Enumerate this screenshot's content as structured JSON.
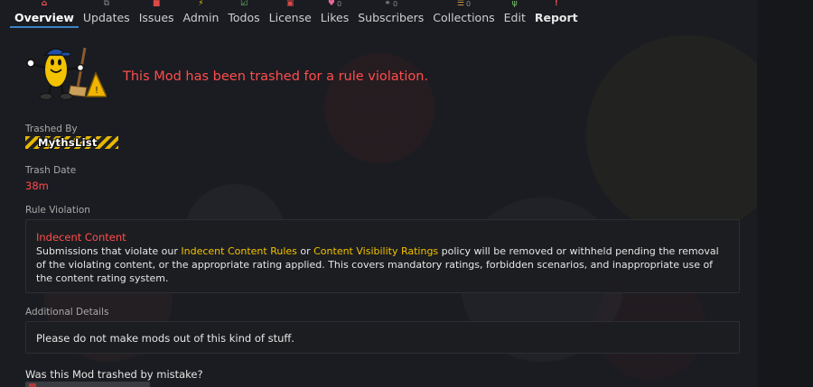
{
  "tabs": [
    {
      "label": "Overview",
      "icon": "home-icon",
      "glyph": "⌂",
      "count": "",
      "active": true
    },
    {
      "label": "Updates",
      "icon": "updates-icon",
      "glyph": "⧉",
      "count": ""
    },
    {
      "label": "Issues",
      "icon": "issues-icon",
      "glyph": "■",
      "count": ""
    },
    {
      "label": "Admin",
      "icon": "admin-icon",
      "glyph": "⚡",
      "count": ""
    },
    {
      "label": "Todos",
      "icon": "todos-icon",
      "glyph": "☑",
      "count": ""
    },
    {
      "label": "License",
      "icon": "license-icon",
      "glyph": "▣",
      "count": ""
    },
    {
      "label": "Likes",
      "icon": "likes-icon",
      "glyph": "♥",
      "count": "0"
    },
    {
      "label": "Subscribers",
      "icon": "subscribers-icon",
      "glyph": "⚭",
      "count": "0"
    },
    {
      "label": "Collections",
      "icon": "collections-icon",
      "glyph": "☰",
      "count": "0"
    },
    {
      "label": "Edit",
      "icon": "edit-icon",
      "glyph": "ψ",
      "count": ""
    },
    {
      "label": "Report",
      "icon": "report-icon",
      "glyph": "!",
      "count": "",
      "bold": true
    }
  ],
  "banner": {
    "message": "This Mod has been trashed for a rule violation."
  },
  "trashed_by": {
    "label": "Trashed By",
    "user": "MythsList"
  },
  "trash_date": {
    "label": "Trash Date",
    "value": "38m"
  },
  "rule_violation": {
    "label": "Rule Violation",
    "title": "Indecent Content",
    "text_1": "Submissions that violate our ",
    "link_1": "Indecent Content Rules",
    "text_2": " or ",
    "link_2": "Content Visibility Ratings",
    "text_3": " policy will be removed or withheld pending the removal of the violating content, or the appropriate rating applied. This covers mandatory ratings, forbidden scenarios, and inappropriate use of the content rating system."
  },
  "additional_details": {
    "label": "Additional Details",
    "text": "Please do not make mods out of this kind of stuff."
  },
  "mistake": {
    "question": "Was this Mod trashed by mistake?"
  },
  "colors": {
    "accent": "#3b82c4",
    "danger": "#ff4d4d",
    "link": "#f2c200"
  }
}
